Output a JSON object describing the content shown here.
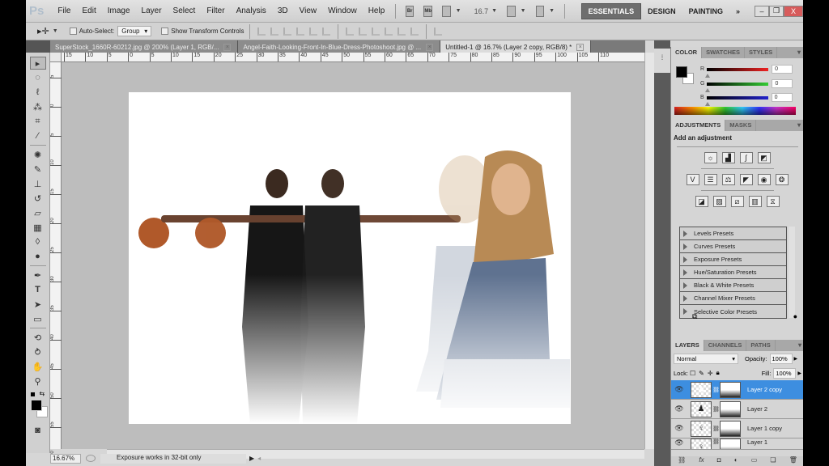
{
  "app": {
    "logo": "Ps"
  },
  "menubar": {
    "items": [
      "File",
      "Edit",
      "Image",
      "Layer",
      "Select",
      "Filter",
      "Analysis",
      "3D",
      "View",
      "Window",
      "Help"
    ],
    "bridge": "Br",
    "minibridge": "Mb",
    "zoom": "16.7",
    "workspaces": [
      "ESSENTIALS",
      "DESIGN",
      "PAINTING"
    ],
    "more": "»",
    "minimize": "–",
    "restore": "❐",
    "close": "X"
  },
  "options": {
    "auto_select_label": "Auto-Select:",
    "auto_select_value": "Group",
    "show_transform_label": "Show Transform Controls"
  },
  "tabs": [
    {
      "label": "SuperStock_1660R-60212.jpg @ 200% (Layer 1, RGB/...",
      "active": false
    },
    {
      "label": "Angel-Faith-Looking-Front-In-Blue-Dress-Photoshoot.jpg @ ...",
      "active": false
    },
    {
      "label": "Untitled-1 @ 16.7% (Layer 2 copy, RGB/8) *",
      "active": true
    }
  ],
  "ruler": {
    "h_ticks": [
      "15",
      "10",
      "5",
      "0",
      "5",
      "10",
      "15",
      "20",
      "25",
      "30",
      "35",
      "40",
      "45",
      "50",
      "55",
      "60",
      "65",
      "70",
      "75",
      "80",
      "85",
      "90",
      "95",
      "100",
      "105",
      "110"
    ],
    "v_ticks": [
      "5",
      "0",
      "5",
      "10",
      "15",
      "20",
      "25",
      "30",
      "35",
      "40",
      "45",
      "50",
      "55",
      "60"
    ]
  },
  "status": {
    "zoom": "16.67%",
    "message": "Exposure works in 32-bit only"
  },
  "color_panel": {
    "tabs": [
      "COLOR",
      "SWATCHES",
      "STYLES"
    ],
    "channels": [
      {
        "label": "R",
        "value": "0",
        "color": "#d33"
      },
      {
        "label": "G",
        "value": "0",
        "color": "#3c3"
      },
      {
        "label": "B",
        "value": "0",
        "color": "#33c"
      }
    ],
    "foreground": "#000000",
    "background": "#ffffff"
  },
  "adjustments_panel": {
    "tabs": [
      "ADJUSTMENTS",
      "MASKS"
    ],
    "title": "Add an adjustment",
    "icon_rows": [
      [
        "brightness-contrast",
        "levels",
        "curves",
        "exposure"
      ],
      [
        "vibrance",
        "hue-saturation",
        "color-balance",
        "black-white",
        "photo-filter",
        "channel-mixer"
      ],
      [
        "invert",
        "posterize",
        "threshold",
        "gradient-map",
        "selective-color"
      ]
    ],
    "presets": [
      "Levels Presets",
      "Curves Presets",
      "Exposure Presets",
      "Hue/Saturation Presets",
      "Black & White Presets",
      "Channel Mixer Presets",
      "Selective Color Presets"
    ]
  },
  "layers_panel": {
    "tabs": [
      "LAYERS",
      "CHANNELS",
      "PATHS"
    ],
    "blend_mode": "Normal",
    "opacity_label": "Opacity:",
    "opacity": "100%",
    "lock_label": "Lock:",
    "fill_label": "Fill:",
    "fill": "100%",
    "layers": [
      {
        "name": "Layer 2 copy",
        "selected": true
      },
      {
        "name": "Layer 2",
        "selected": false
      },
      {
        "name": "Layer 1 copy",
        "selected": false
      },
      {
        "name": "Layer 1",
        "selected": false
      }
    ],
    "footer_icons": [
      "link",
      "fx",
      "mask",
      "adjustment",
      "group",
      "new-layer",
      "delete"
    ]
  }
}
